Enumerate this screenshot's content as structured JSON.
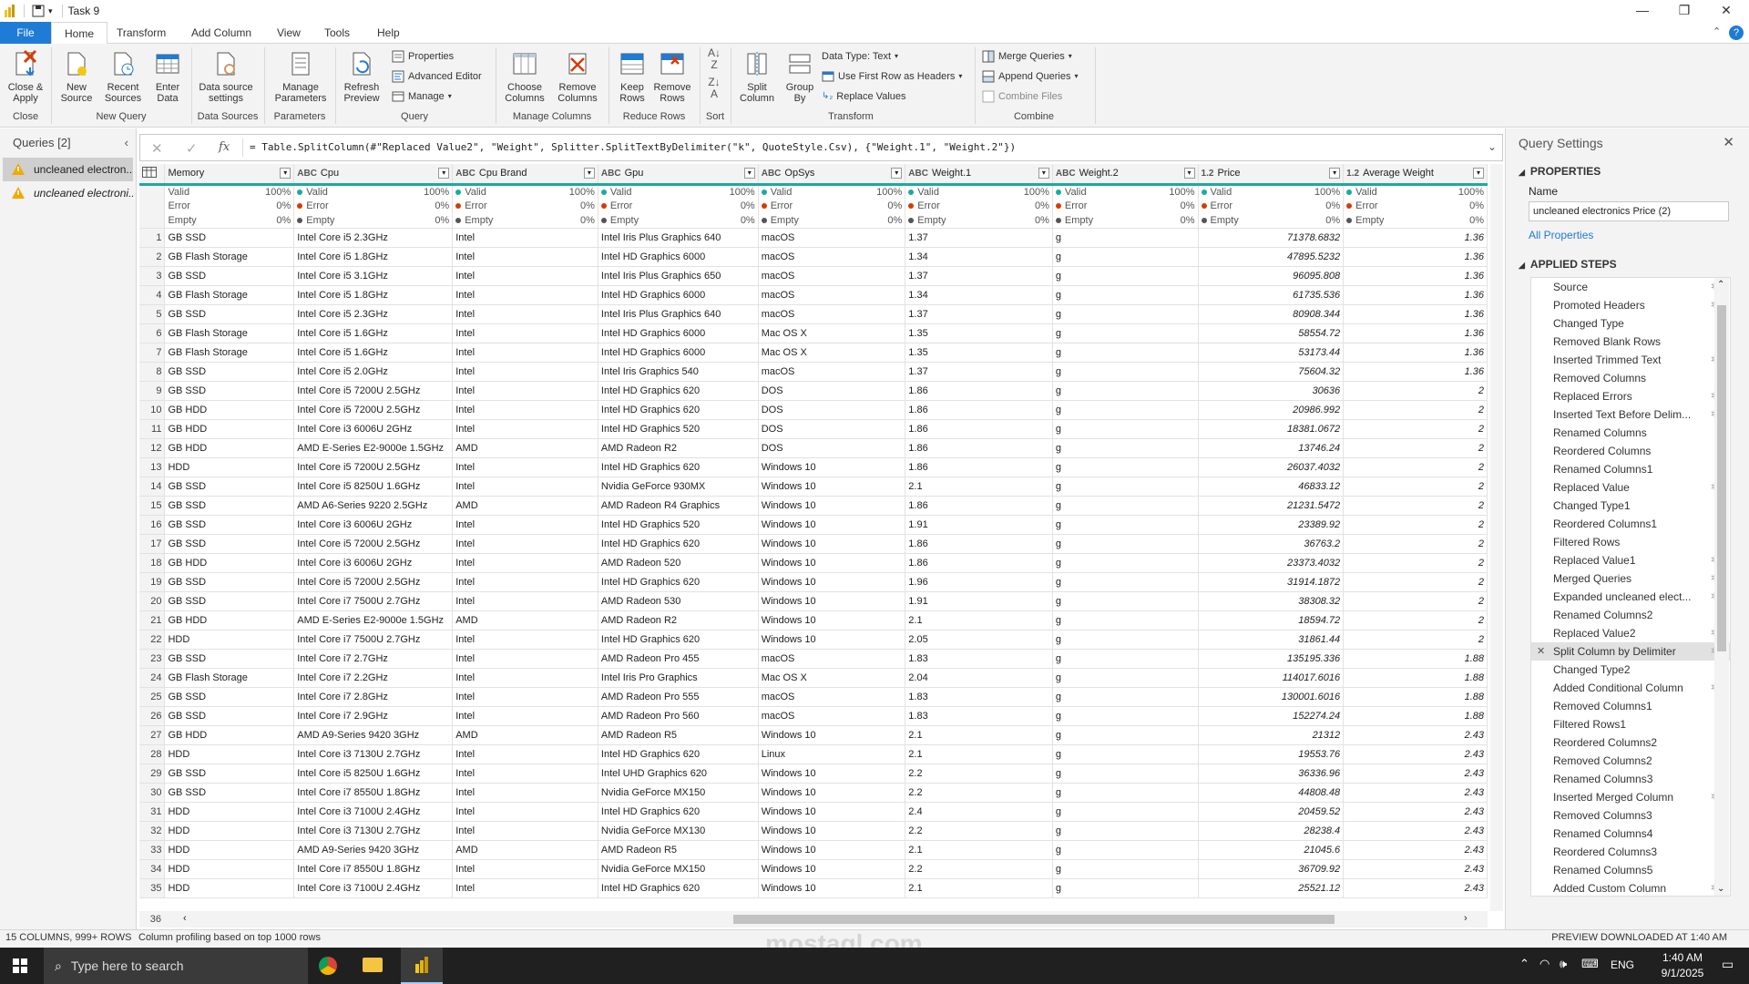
{
  "window": {
    "title": "Task 9"
  },
  "tabs": [
    "File",
    "Home",
    "Transform",
    "Add Column",
    "View",
    "Tools",
    "Help"
  ],
  "ribbon": {
    "close_apply": "Close &\nApply",
    "new_source": "New\nSource",
    "recent_sources": "Recent\nSources",
    "enter_data": "Enter\nData",
    "data_source_settings": "Data source\nsettings",
    "manage_parameters": "Manage\nParameters",
    "refresh_preview": "Refresh\nPreview",
    "properties": "Properties",
    "advanced_editor": "Advanced Editor",
    "manage": "Manage",
    "choose_columns": "Choose\nColumns",
    "remove_columns": "Remove\nColumns",
    "keep_rows": "Keep\nRows",
    "remove_rows": "Remove\nRows",
    "split_column": "Split\nColumn",
    "group_by": "Group\nBy",
    "data_type": "Data Type: Text",
    "use_first_row": "Use First Row as Headers",
    "replace_values": "Replace Values",
    "merge_queries": "Merge Queries",
    "append_queries": "Append Queries",
    "combine_files": "Combine Files",
    "groups": [
      "Close",
      "New Query",
      "Data Sources",
      "Parameters",
      "Query",
      "Manage Columns",
      "Reduce Rows",
      "Sort",
      "Transform",
      "Combine"
    ]
  },
  "queries": {
    "title": "Queries [2]",
    "items": [
      "uncleaned electron...",
      "uncleaned electroni..."
    ]
  },
  "formula": "= Table.SplitColumn(#\"Replaced Value2\", \"Weight\", Splitter.SplitTextByDelimiter(\"k\", QuoteStyle.Csv), {\"Weight.1\", \"Weight.2\"})",
  "columns": [
    {
      "type": "",
      "name": "Memory"
    },
    {
      "type": "ABC",
      "name": "Cpu"
    },
    {
      "type": "ABC",
      "name": "Cpu Brand"
    },
    {
      "type": "ABC",
      "name": "Gpu"
    },
    {
      "type": "ABC",
      "name": "OpSys"
    },
    {
      "type": "ABC",
      "name": "Weight.1"
    },
    {
      "type": "ABC",
      "name": "Weight.2"
    },
    {
      "type": "1.2",
      "name": "Price"
    },
    {
      "type": "1.2",
      "name": "Average Weight"
    }
  ],
  "profile": {
    "valid": "Valid",
    "error": "Error",
    "empty": "Empty",
    "p100": "100%",
    "p0": "0%"
  },
  "rows": [
    [
      "GB SSD",
      "Intel Core i5 2.3GHz",
      "Intel",
      "Intel Iris Plus Graphics 640",
      "macOS",
      "1.37",
      "g",
      "71378.6832",
      "1.36"
    ],
    [
      "GB Flash Storage",
      "Intel Core i5 1.8GHz",
      "Intel",
      "Intel HD Graphics 6000",
      "macOS",
      "1.34",
      "g",
      "47895.5232",
      "1.36"
    ],
    [
      "GB SSD",
      "Intel Core i5 3.1GHz",
      "Intel",
      "Intel Iris Plus Graphics 650",
      "macOS",
      "1.37",
      "g",
      "96095.808",
      "1.36"
    ],
    [
      "GB Flash Storage",
      "Intel Core i5 1.8GHz",
      "Intel",
      "Intel HD Graphics 6000",
      "macOS",
      "1.34",
      "g",
      "61735.536",
      "1.36"
    ],
    [
      "GB SSD",
      "Intel Core i5 2.3GHz",
      "Intel",
      "Intel Iris Plus Graphics 640",
      "macOS",
      "1.37",
      "g",
      "80908.344",
      "1.36"
    ],
    [
      "GB Flash Storage",
      "Intel Core i5 1.6GHz",
      "Intel",
      "Intel HD Graphics 6000",
      "Mac OS X",
      "1.35",
      "g",
      "58554.72",
      "1.36"
    ],
    [
      "GB Flash Storage",
      "Intel Core i5 1.6GHz",
      "Intel",
      "Intel HD Graphics 6000",
      "Mac OS X",
      "1.35",
      "g",
      "53173.44",
      "1.36"
    ],
    [
      "GB SSD",
      "Intel Core i5 2.0GHz",
      "Intel",
      "Intel Iris Graphics 540",
      "macOS",
      "1.37",
      "g",
      "75604.32",
      "1.36"
    ],
    [
      "GB SSD",
      "Intel Core i5 7200U 2.5GHz",
      "Intel",
      "Intel HD Graphics 620",
      "DOS",
      "1.86",
      "g",
      "30636",
      "2"
    ],
    [
      "GB HDD",
      "Intel Core i5 7200U 2.5GHz",
      "Intel",
      "Intel HD Graphics 620",
      "DOS",
      "1.86",
      "g",
      "20986.992",
      "2"
    ],
    [
      "GB HDD",
      "Intel Core i3 6006U 2GHz",
      "Intel",
      "Intel HD Graphics 520",
      "DOS",
      "1.86",
      "g",
      "18381.0672",
      "2"
    ],
    [
      "GB HDD",
      "AMD E-Series E2-9000e 1.5GHz",
      "AMD",
      "AMD Radeon R2",
      "DOS",
      "1.86",
      "g",
      "13746.24",
      "2"
    ],
    [
      "HDD",
      "Intel Core i5 7200U 2.5GHz",
      "Intel",
      "Intel HD Graphics 620",
      "Windows 10",
      "1.86",
      "g",
      "26037.4032",
      "2"
    ],
    [
      "GB SSD",
      "Intel Core i5 8250U 1.6GHz",
      "Intel",
      "Nvidia GeForce 930MX",
      "Windows 10",
      "2.1",
      "g",
      "46833.12",
      "2"
    ],
    [
      "GB SSD",
      "AMD A6-Series 9220 2.5GHz",
      "AMD",
      "AMD Radeon R4 Graphics",
      "Windows 10",
      "1.86",
      "g",
      "21231.5472",
      "2"
    ],
    [
      "GB SSD",
      "Intel Core i3 6006U 2GHz",
      "Intel",
      "Intel HD Graphics 520",
      "Windows 10",
      "1.91",
      "g",
      "23389.92",
      "2"
    ],
    [
      "GB SSD",
      "Intel Core i5 7200U 2.5GHz",
      "Intel",
      "Intel HD Graphics 620",
      "Windows 10",
      "1.86",
      "g",
      "36763.2",
      "2"
    ],
    [
      "GB HDD",
      "Intel Core i3 6006U 2GHz",
      "Intel",
      "AMD Radeon 520",
      "Windows 10",
      "1.86",
      "g",
      "23373.4032",
      "2"
    ],
    [
      "GB SSD",
      "Intel Core i5 7200U 2.5GHz",
      "Intel",
      "Intel HD Graphics 620",
      "Windows 10",
      "1.96",
      "g",
      "31914.1872",
      "2"
    ],
    [
      "GB SSD",
      "Intel Core i7 7500U 2.7GHz",
      "Intel",
      "AMD Radeon 530",
      "Windows 10",
      "1.91",
      "g",
      "38308.32",
      "2"
    ],
    [
      "GB HDD",
      "AMD E-Series E2-9000e 1.5GHz",
      "AMD",
      "AMD Radeon R2",
      "Windows 10",
      "2.1",
      "g",
      "18594.72",
      "2"
    ],
    [
      "HDD",
      "Intel Core i7 7500U 2.7GHz",
      "Intel",
      "Intel HD Graphics 620",
      "Windows 10",
      "2.05",
      "g",
      "31861.44",
      "2"
    ],
    [
      "GB SSD",
      "Intel Core i7 2.7GHz",
      "Intel",
      "AMD Radeon Pro 455",
      "macOS",
      "1.83",
      "g",
      "135195.336",
      "1.88"
    ],
    [
      "GB Flash Storage",
      "Intel Core i7 2.2GHz",
      "Intel",
      "Intel Iris Pro Graphics",
      "Mac OS X",
      "2.04",
      "g",
      "114017.6016",
      "1.88"
    ],
    [
      "GB SSD",
      "Intel Core i7 2.8GHz",
      "Intel",
      "AMD Radeon Pro 555",
      "macOS",
      "1.83",
      "g",
      "130001.6016",
      "1.88"
    ],
    [
      "GB SSD",
      "Intel Core i7 2.9GHz",
      "Intel",
      "AMD Radeon Pro 560",
      "macOS",
      "1.83",
      "g",
      "152274.24",
      "1.88"
    ],
    [
      "GB HDD",
      "AMD A9-Series 9420 3GHz",
      "AMD",
      "AMD Radeon R5",
      "Windows 10",
      "2.1",
      "g",
      "21312",
      "2.43"
    ],
    [
      "HDD",
      "Intel Core i3 7130U 2.7GHz",
      "Intel",
      "Intel HD Graphics 620",
      "Linux",
      "2.1",
      "g",
      "19553.76",
      "2.43"
    ],
    [
      "GB SSD",
      "Intel Core i5 8250U 1.6GHz",
      "Intel",
      "Intel UHD Graphics 620",
      "Windows 10",
      "2.2",
      "g",
      "36336.96",
      "2.43"
    ],
    [
      "GB SSD",
      "Intel Core i7 8550U 1.8GHz",
      "Intel",
      "Nvidia GeForce MX150",
      "Windows 10",
      "2.2",
      "g",
      "44808.48",
      "2.43"
    ],
    [
      "HDD",
      "Intel Core i3 7100U 2.4GHz",
      "Intel",
      "Intel HD Graphics 620",
      "Windows 10",
      "2.4",
      "g",
      "20459.52",
      "2.43"
    ],
    [
      "HDD",
      "Intel Core i3 7130U 2.7GHz",
      "Intel",
      "Nvidia GeForce MX130",
      "Windows 10",
      "2.2",
      "g",
      "28238.4",
      "2.43"
    ],
    [
      "HDD",
      "AMD A9-Series 9420 3GHz",
      "AMD",
      "AMD Radeon R5",
      "Windows 10",
      "2.1",
      "g",
      "21045.6",
      "2.43"
    ],
    [
      "HDD",
      "Intel Core i7 8550U 1.8GHz",
      "Intel",
      "Nvidia GeForce MX150",
      "Windows 10",
      "2.2",
      "g",
      "36709.92",
      "2.43"
    ],
    [
      "HDD",
      "Intel Core i3 7100U 2.4GHz",
      "Intel",
      "Intel HD Graphics 620",
      "Windows 10",
      "2.1",
      "g",
      "25521.12",
      "2.43"
    ]
  ],
  "extra_row_number": "36",
  "settings": {
    "title": "Query Settings",
    "properties": "PROPERTIES",
    "name_label": "Name",
    "name_value": "uncleaned electronics Price (2)",
    "all_properties": "All Properties",
    "applied_steps": "APPLIED STEPS",
    "steps": [
      {
        "n": "Source",
        "g": true
      },
      {
        "n": "Promoted Headers",
        "g": true
      },
      {
        "n": "Changed Type",
        "g": false
      },
      {
        "n": "Removed Blank Rows",
        "g": false
      },
      {
        "n": "Inserted Trimmed Text",
        "g": true
      },
      {
        "n": "Removed Columns",
        "g": false
      },
      {
        "n": "Replaced Errors",
        "g": true
      },
      {
        "n": "Inserted Text Before Delim...",
        "g": true
      },
      {
        "n": "Renamed Columns",
        "g": false
      },
      {
        "n": "Reordered Columns",
        "g": false
      },
      {
        "n": "Renamed Columns1",
        "g": false
      },
      {
        "n": "Replaced Value",
        "g": true
      },
      {
        "n": "Changed Type1",
        "g": false
      },
      {
        "n": "Reordered Columns1",
        "g": false
      },
      {
        "n": "Filtered Rows",
        "g": false
      },
      {
        "n": "Replaced Value1",
        "g": true
      },
      {
        "n": "Merged Queries",
        "g": true
      },
      {
        "n": "Expanded uncleaned elect...",
        "g": true
      },
      {
        "n": "Renamed Columns2",
        "g": false
      },
      {
        "n": "Replaced Value2",
        "g": true
      },
      {
        "n": "Split Column by Delimiter",
        "g": true,
        "cur": true
      },
      {
        "n": "Changed Type2",
        "g": false
      },
      {
        "n": "Added Conditional Column",
        "g": true
      },
      {
        "n": "Removed Columns1",
        "g": false
      },
      {
        "n": "Filtered Rows1",
        "g": false
      },
      {
        "n": "Reordered Columns2",
        "g": false
      },
      {
        "n": "Removed Columns2",
        "g": false
      },
      {
        "n": "Renamed Columns3",
        "g": false
      },
      {
        "n": "Inserted Merged Column",
        "g": true
      },
      {
        "n": "Removed Columns3",
        "g": false
      },
      {
        "n": "Renamed Columns4",
        "g": false
      },
      {
        "n": "Reordered Columns3",
        "g": false
      },
      {
        "n": "Renamed Columns5",
        "g": false
      },
      {
        "n": "Added Custom Column",
        "g": true
      }
    ]
  },
  "status": {
    "left": "15 COLUMNS, 999+ ROWS",
    "profiling": "Column profiling based on top 1000 rows",
    "right": "PREVIEW DOWNLOADED AT 1:40 AM"
  },
  "taskbar": {
    "search": "Type here to search",
    "lang": "ENG",
    "time": "1:40 AM",
    "date": "9/1/2025"
  },
  "watermark": "mostaql.com",
  "colors": {
    "accent": "#1e7bd6",
    "profile_bar": "#1aab99",
    "valid_dot": "#1aab99",
    "error_dot": "#d83b01",
    "empty_dot": "#555555"
  }
}
